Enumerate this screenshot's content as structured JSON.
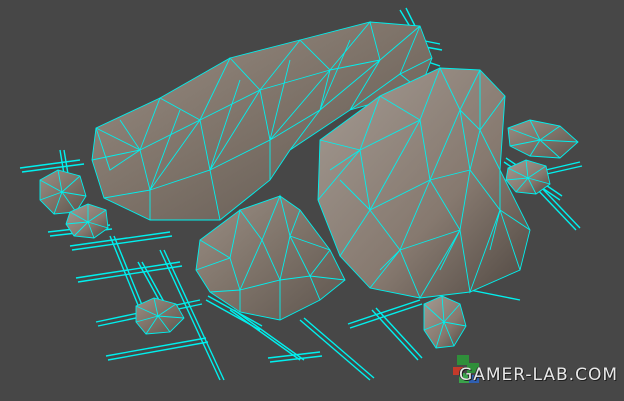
{
  "viewport": {
    "background_color": "#474747",
    "wireframe_color": "#00f0ee",
    "rock_color": "#8a7e74"
  },
  "watermark": {
    "text": "GAMER-LAB.COM",
    "logo_icon": "gamer-lab-logo-icon",
    "logo_colors": [
      "#2f8f3a",
      "#c43a2a",
      "#2f5fb0"
    ]
  }
}
